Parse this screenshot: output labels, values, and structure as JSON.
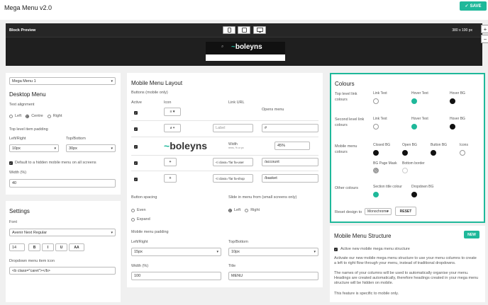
{
  "header": {
    "title": "Mega Menu v2.0",
    "save_label": "SAVE"
  },
  "preview": {
    "label": "Block Preview",
    "dims": "380 x 100 px",
    "zoom_in": "+",
    "zoom_out": "−",
    "logo_text": "boleyns"
  },
  "left": {
    "menu_select": "Mega Menu 1",
    "desktop_title": "Desktop Menu",
    "text_alignment_label": "Text alignment",
    "align_left": "Left",
    "align_centre": "Centre",
    "align_right": "Right",
    "top_level_padding_label": "Top level item padding",
    "lr_label": "Left/Right",
    "tb_label": "Top/Bottom",
    "lr_value": "10px",
    "tb_value": "30px",
    "default_hidden_label": "Default to a hidden mobile menu on all screens",
    "width_label": "Width (%)",
    "width_value": "40",
    "settings_title": "Settings",
    "font_label": "Font",
    "font_value": "Avenir Next Regular",
    "font_size": "14",
    "bold": "B",
    "italic": "I",
    "underline": "U",
    "caps": "AA",
    "dropdown_icon_label": "Dropdown menu item icon",
    "dropdown_icon_value": "<b class=\"caret\"></b>"
  },
  "middle": {
    "title": "Mobile Menu Layout",
    "buttons_label": "Buttons (mobile only)",
    "col_active": "Active",
    "col_icon": "Icon",
    "col_link": "Link URL",
    "col_opens": "Opens menu",
    "rows": [
      {
        "icon": "≡ ▾",
        "link": "",
        "link_placeholder": "",
        "value": ""
      },
      {
        "icon": "⌕ ▾",
        "link": "",
        "link_placeholder": "Label",
        "value": "#"
      },
      {
        "icon": "",
        "link": "",
        "link_placeholder": "",
        "value": "45%"
      },
      {
        "icon": "+",
        "link": "<i class=\"far fa-user",
        "link_placeholder": "",
        "value": "/account"
      },
      {
        "icon": "+",
        "link": "<i class=\"far fa-shop",
        "link_placeholder": "",
        "value": "/basket"
      }
    ],
    "logo_width_label": "Width",
    "logo_width_hint": "rems, % or px",
    "button_spacing_label": "Button spacing",
    "spacing_even": "Even",
    "spacing_expand": "Expand",
    "slide_label": "Slide in menu from (small screens only)",
    "slide_left": "Left",
    "slide_right": "Right",
    "padding_label": "Mobile menu padding",
    "lr_label": "Left/Right",
    "tb_label": "Top/Bottom",
    "lr_value": "15px",
    "tb_value": "10px",
    "width_label": "Width (%)",
    "width_value": "100",
    "title_label": "Title",
    "title_value": "MENU"
  },
  "colours": {
    "title": "Colours",
    "top_level_label": "Top level link colours",
    "second_level_label": "Second level link colours",
    "mobile_label": "Mobile menu colours",
    "other_label": "Other colours",
    "link_text": "Link Text",
    "hover_text": "Hover Text",
    "hover_bg": "Hover BG",
    "closed_bg": "Closed BG",
    "open_bg": "Open BG",
    "button_bg": "Button BG",
    "icons": "Icons",
    "bg_page_mask": "BG Page Mask",
    "bottom_border": "Bottom border",
    "section_title_colour": "Section title colour",
    "dropdown_bg": "Dropdown BG",
    "reset_label": "Reset design to",
    "reset_select": "Monochrome",
    "reset_button": "RESET",
    "accent": "#1fb89a",
    "dark": "#111111",
    "light": "#ffffff"
  },
  "structure": {
    "title": "Mobile Menu Structure",
    "badge": "NEW",
    "active_label": "Active new mobile mega menu structure",
    "para1": "Activate our new mobile mega menu structure to use your menu columns to create a left to right flow through your menu, instead of traditional dropdowns.",
    "para2": "The names of your columns will be used to automatically organise your menu. Headings are created automatically, therefore headings created in your mega menu structure will be hidden on mobile.",
    "para3": "This feature is specific to mobile only."
  }
}
